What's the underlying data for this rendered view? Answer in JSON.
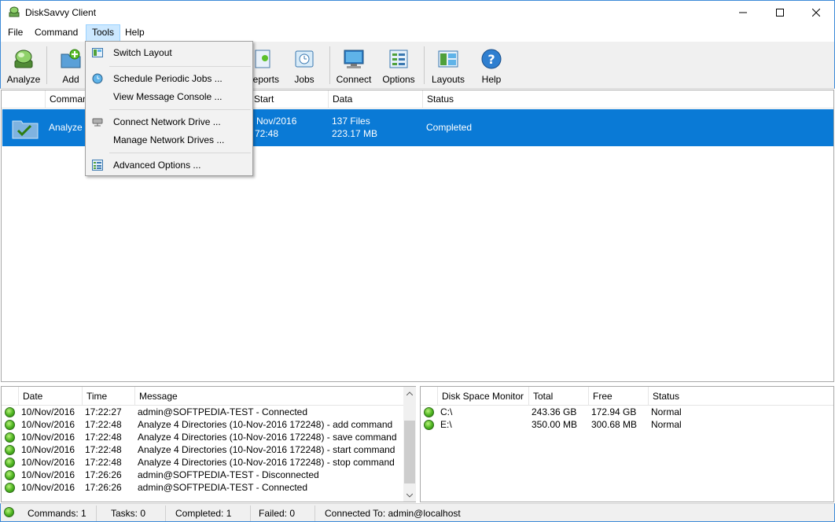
{
  "window": {
    "title": "DiskSavvy Client"
  },
  "menubar": {
    "items": [
      "File",
      "Command",
      "Tools",
      "Help"
    ]
  },
  "toolbar": {
    "buttons": [
      {
        "label": "Analyze",
        "icon": "analyze-icon"
      },
      {
        "label": "Add",
        "icon": "add-icon"
      },
      {
        "label": "Reports",
        "icon": "reports-icon"
      },
      {
        "label": "Jobs",
        "icon": "jobs-icon"
      },
      {
        "label": "Connect",
        "icon": "connect-icon"
      },
      {
        "label": "Options",
        "icon": "options-icon"
      },
      {
        "label": "Layouts",
        "icon": "layouts-icon"
      },
      {
        "label": "Help",
        "icon": "help-icon"
      }
    ]
  },
  "tools_menu": {
    "items": [
      {
        "label": "Switch Layout",
        "icon": "switch-layout-icon"
      },
      {
        "label": "Schedule Periodic Jobs ...",
        "icon": "schedule-icon"
      },
      {
        "label": "View Message Console ...",
        "icon": ""
      },
      {
        "label": "Connect Network Drive ...",
        "icon": "network-drive-icon"
      },
      {
        "label": "Manage Network Drives ...",
        "icon": ""
      },
      {
        "label": "Advanced Options ...",
        "icon": "advanced-options-icon"
      }
    ]
  },
  "commands": {
    "columns": [
      "Command",
      "Start",
      "Data",
      "Status"
    ],
    "rows": [
      {
        "name": "Analyze 4",
        "start_line1": "Nov/2016",
        "start_line2": "72:48",
        "data_line1": "137 Files",
        "data_line2": "223.17 MB",
        "status": "Completed"
      }
    ]
  },
  "log": {
    "columns": [
      "Date",
      "Time",
      "Message"
    ],
    "rows": [
      {
        "date": "10/Nov/2016",
        "time": "17:22:27",
        "message": "admin@SOFTPEDIA-TEST - Connected"
      },
      {
        "date": "10/Nov/2016",
        "time": "17:22:48",
        "message": "Analyze 4 Directories (10-Nov-2016 172248) - add command"
      },
      {
        "date": "10/Nov/2016",
        "time": "17:22:48",
        "message": "Analyze 4 Directories (10-Nov-2016 172248) - save command"
      },
      {
        "date": "10/Nov/2016",
        "time": "17:22:48",
        "message": "Analyze 4 Directories (10-Nov-2016 172248) - start command"
      },
      {
        "date": "10/Nov/2016",
        "time": "17:22:48",
        "message": "Analyze 4 Directories (10-Nov-2016 172248) - stop command"
      },
      {
        "date": "10/Nov/2016",
        "time": "17:26:26",
        "message": "admin@SOFTPEDIA-TEST - Disconnected"
      },
      {
        "date": "10/Nov/2016",
        "time": "17:26:26",
        "message": "admin@SOFTPEDIA-TEST - Connected"
      }
    ]
  },
  "disk_monitor": {
    "columns": [
      "Disk Space Monitor",
      "Total",
      "Free",
      "Status"
    ],
    "rows": [
      {
        "drive": "C:\\",
        "total": "243.36 GB",
        "free": "172.94 GB",
        "status": "Normal"
      },
      {
        "drive": "E:\\",
        "total": "350.00 MB",
        "free": "300.68 MB",
        "status": "Normal"
      }
    ]
  },
  "statusbar": {
    "commands": "Commands: 1",
    "tasks": "Tasks: 0",
    "completed": "Completed: 1",
    "failed": "Failed: 0",
    "connected": "Connected To: admin@localhost"
  },
  "colors": {
    "selection": "#0a7ad6",
    "menu_highlight": "#cce8ff",
    "status_ok": "#4cb320"
  }
}
